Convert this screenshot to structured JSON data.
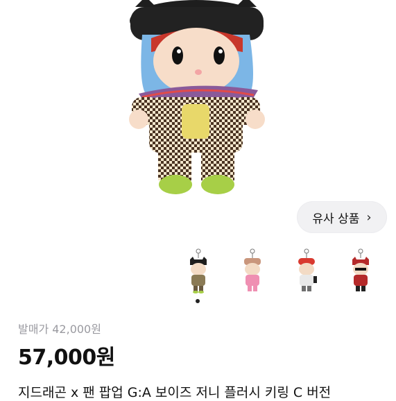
{
  "product": {
    "similar_button_label": "유사 상품",
    "original_price": "발매가 42,000원",
    "price": "57,000원",
    "title": "지드래곤 x 팬 팝업 G:A 보이즈 저니 플러시 키링 C 버전"
  },
  "icons": {
    "similar_chevron": "chevron-right-icon"
  },
  "gallery": {
    "thumbnail_count": 4,
    "active_index": 0
  }
}
